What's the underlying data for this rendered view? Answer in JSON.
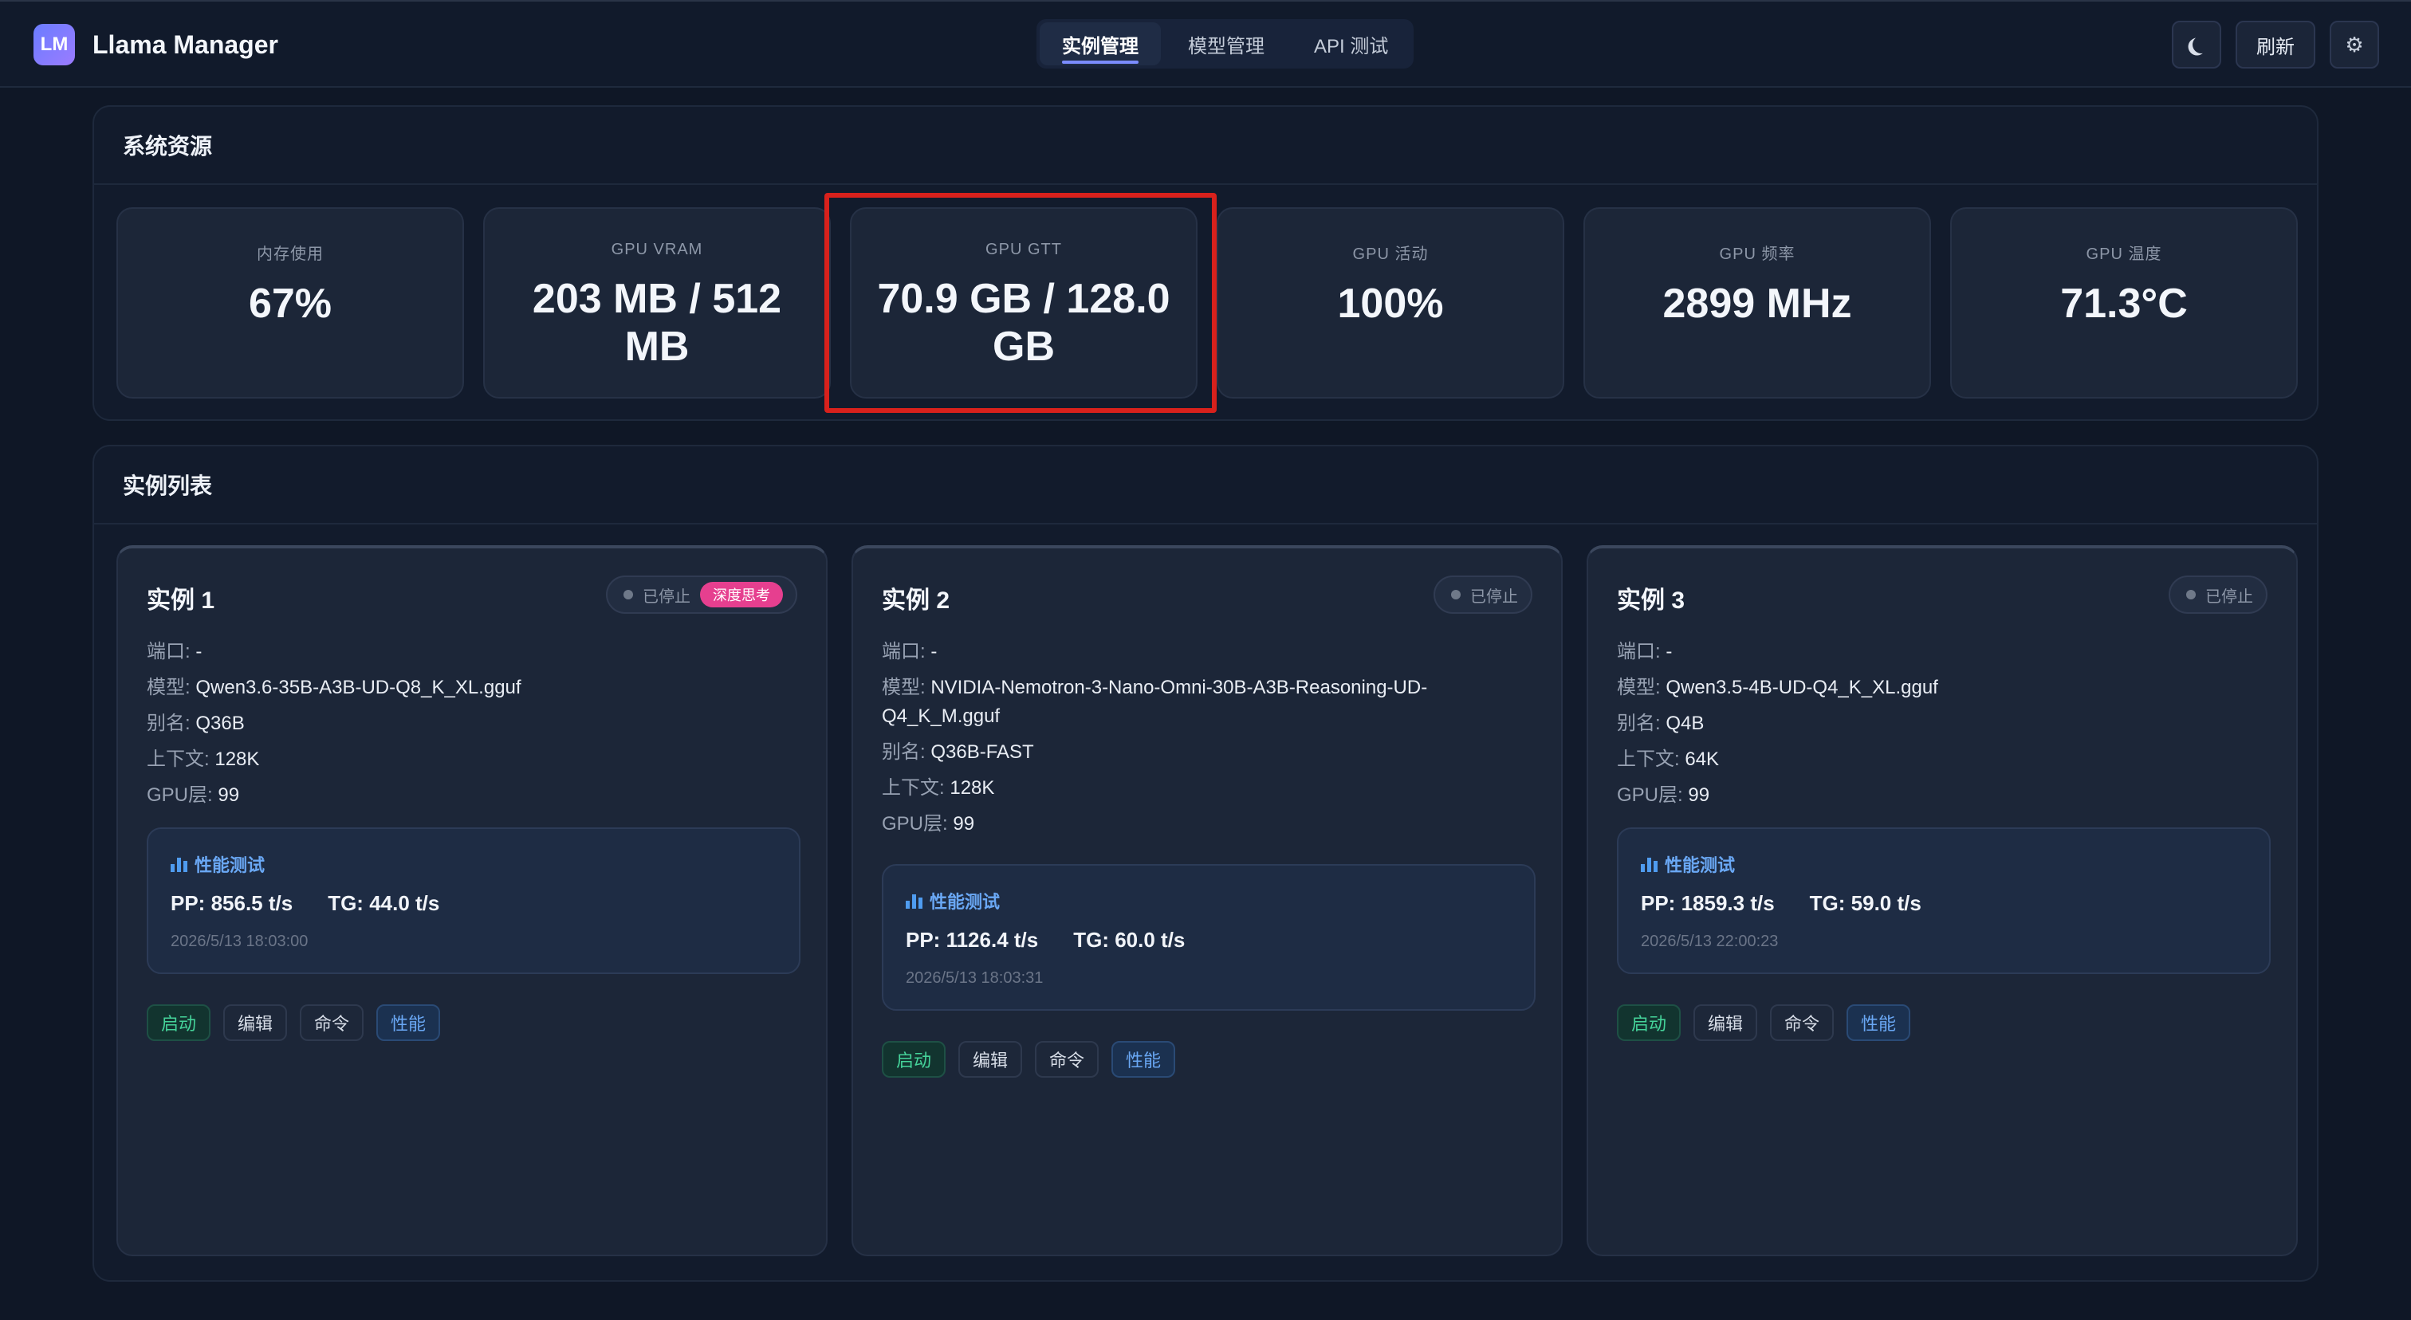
{
  "header": {
    "logo_text": "LM",
    "app_title": "Llama Manager",
    "tabs": [
      {
        "label": "实例管理",
        "active": true
      },
      {
        "label": "模型管理",
        "active": false
      },
      {
        "label": "API 测试",
        "active": false
      }
    ],
    "theme_icon": "moon-icon",
    "refresh_label": "刷新",
    "settings_icon": "gear-icon",
    "settings_glyph": "⚙"
  },
  "system": {
    "title": "系统资源",
    "stats": [
      {
        "label": "内存使用",
        "value": "67%"
      },
      {
        "label": "GPU VRAM",
        "value": "203 MB / 512 MB"
      },
      {
        "label": "GPU GTT",
        "value": "70.9 GB / 128.0 GB"
      },
      {
        "label": "GPU 活动",
        "value": "100%"
      },
      {
        "label": "GPU 频率",
        "value": "2899 MHz"
      },
      {
        "label": "GPU 温度",
        "value": "71.3°C"
      }
    ]
  },
  "instances": {
    "title": "实例列表",
    "field_labels": {
      "port": "端口: ",
      "model": "模型: ",
      "alias": "别名: ",
      "context": "上下文: ",
      "gpu_layers": "GPU层: "
    },
    "perf_title": "性能测试",
    "action_labels": {
      "start": "启动",
      "edit": "编辑",
      "command": "命令",
      "perf": "性能"
    },
    "items": [
      {
        "name": "实例 1",
        "status": "已停止",
        "tag": "深度思考",
        "port": "-",
        "model": "Qwen3.6-35B-A3B-UD-Q8_K_XL.gguf",
        "alias": "Q36B",
        "context": "128K",
        "gpu_layers": "99",
        "pp": "PP: 856.5 t/s",
        "tg": "TG: 44.0 t/s",
        "time": "2026/5/13 18:03:00"
      },
      {
        "name": "实例 2",
        "status": "已停止",
        "tag": "",
        "port": "-",
        "model": "NVIDIA-Nemotron-3-Nano-Omni-30B-A3B-Reasoning-UD-Q4_K_M.gguf",
        "alias": "Q36B-FAST",
        "context": "128K",
        "gpu_layers": "99",
        "pp": "PP: 1126.4 t/s",
        "tg": "TG: 60.0 t/s",
        "time": "2026/5/13 18:03:31"
      },
      {
        "name": "实例 3",
        "status": "已停止",
        "tag": "",
        "port": "-",
        "model": "Qwen3.5-4B-UD-Q4_K_XL.gguf",
        "alias": "Q4B",
        "context": "64K",
        "gpu_layers": "99",
        "pp": "PP: 1859.3 t/s",
        "tg": "TG: 59.0 t/s",
        "time": "2026/5/13 22:00:23"
      }
    ]
  },
  "colors": {
    "background": "#0f1726",
    "card": "#1c2638",
    "accent": "#7b8cff",
    "start_green": "#45d39a",
    "perf_blue": "#6aa8f5",
    "tag_pink": "#e63f8f",
    "highlight_red": "#d8211c"
  }
}
